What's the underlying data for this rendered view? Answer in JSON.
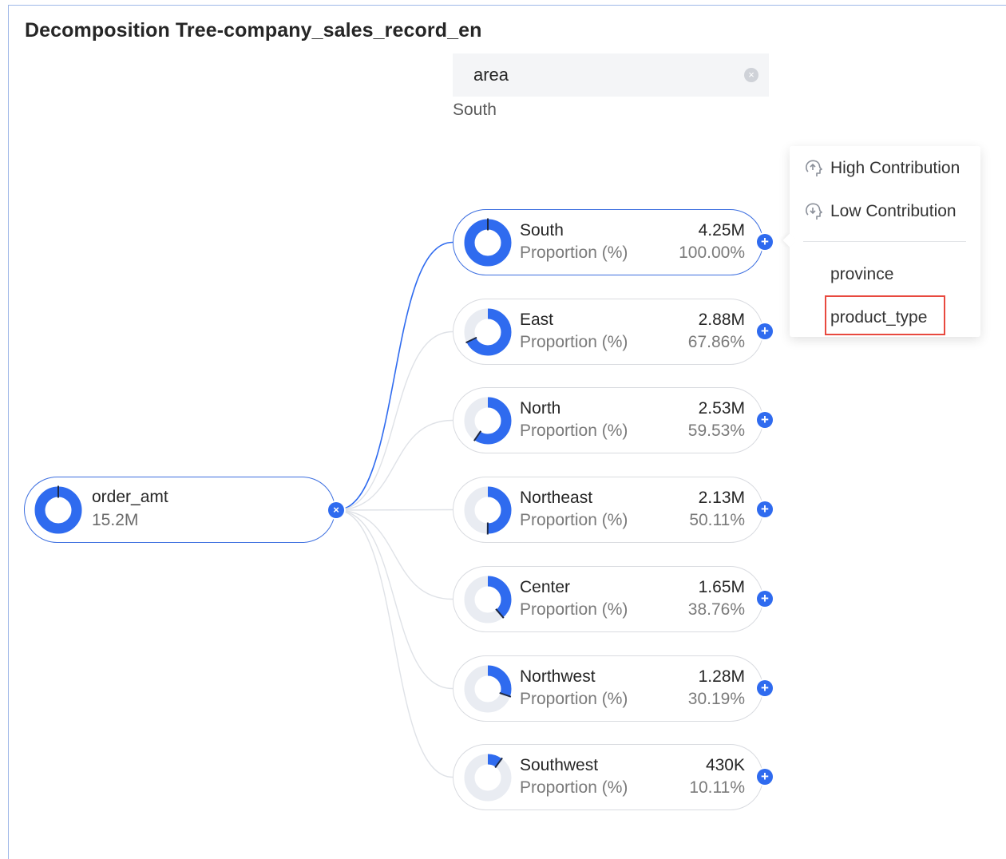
{
  "title": "Decomposition Tree-company_sales_record_en",
  "filter": {
    "label": "area",
    "clear_icon": "×",
    "value": "South"
  },
  "root": {
    "name": "order_amt",
    "value": "15.2M",
    "fraction": 1.0
  },
  "node_sublabel": "Proportion (%)",
  "nodes": [
    {
      "name": "South",
      "value": "4.25M",
      "pct": "100.00%",
      "fraction": 1.0
    },
    {
      "name": "East",
      "value": "2.88M",
      "pct": "67.86%",
      "fraction": 0.6786
    },
    {
      "name": "North",
      "value": "2.53M",
      "pct": "59.53%",
      "fraction": 0.5953
    },
    {
      "name": "Northeast",
      "value": "2.13M",
      "pct": "50.11%",
      "fraction": 0.5011
    },
    {
      "name": "Center",
      "value": "1.65M",
      "pct": "38.76%",
      "fraction": 0.3876
    },
    {
      "name": "Northwest",
      "value": "1.28M",
      "pct": "30.19%",
      "fraction": 0.3019
    },
    {
      "name": "Southwest",
      "value": "430K",
      "pct": "10.11%",
      "fraction": 0.1011
    }
  ],
  "expand_icon": "+",
  "collapse_icon": "×",
  "menu": {
    "high_contribution": "High Contribution",
    "low_contribution": "Low Contribution",
    "dimensions": [
      "province",
      "product_type"
    ]
  },
  "colors": {
    "accent": "#2f6bef",
    "donut_track": "#e9ecf2",
    "selected_border": "#3d6fe0",
    "highlight": "#e8493f"
  }
}
